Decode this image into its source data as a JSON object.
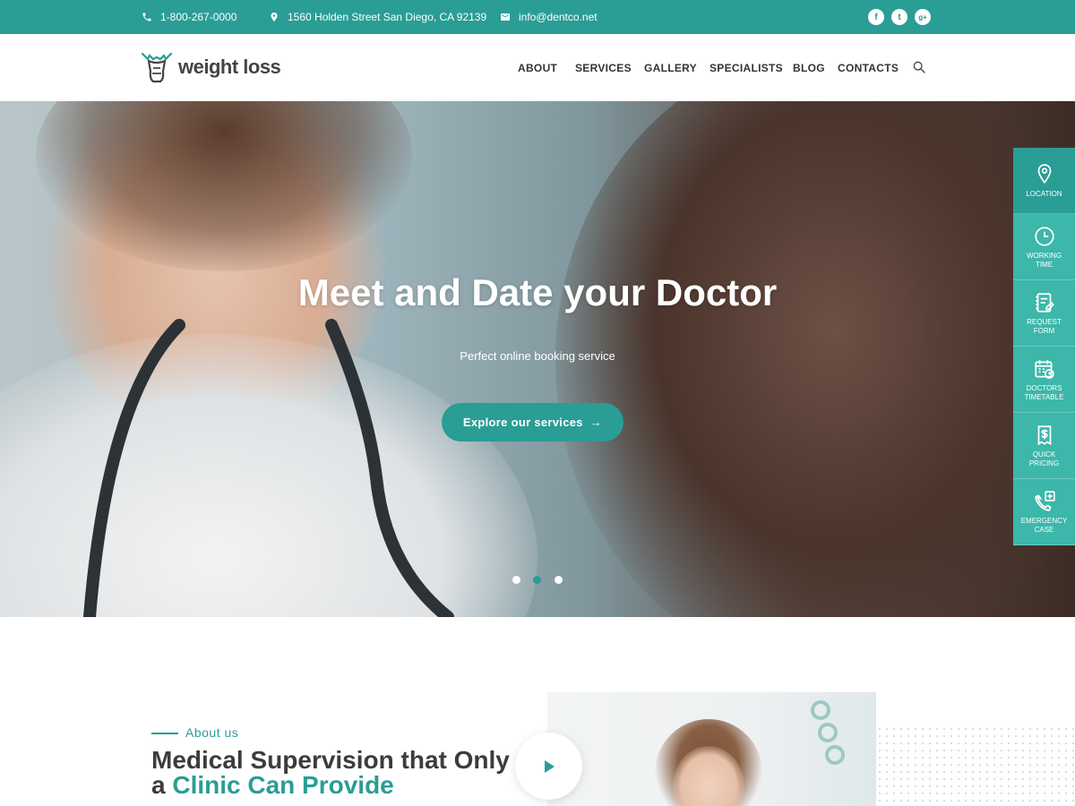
{
  "topbar": {
    "phone": "1-800-267-0000",
    "address": "1560 Holden Street San Diego, CA 92139",
    "email": "info@dentco.net",
    "social": [
      {
        "icon": "facebook-icon",
        "glyph": "f"
      },
      {
        "icon": "twitter-icon",
        "glyph": "t"
      },
      {
        "icon": "google-plus-icon",
        "glyph": "g+"
      }
    ]
  },
  "header": {
    "logo_text": "weight loss",
    "nav": [
      "ABOUT",
      "SERVICES",
      "GALLERY",
      "SPECIALISTS",
      "BLOG",
      "CONTACTS"
    ]
  },
  "hero": {
    "title": "Meet and Date your Doctor",
    "subtitle": "Perfect online booking service",
    "cta_label": "Explore our services",
    "cta_arrow": "→",
    "slides": 3,
    "active_slide": 2
  },
  "side_panel": [
    {
      "icon": "location-pin-icon",
      "label": "LOCATION"
    },
    {
      "icon": "clock-icon",
      "label": "WORKING TIME"
    },
    {
      "icon": "request-form-icon",
      "label": "REQUEST FORM"
    },
    {
      "icon": "calendar-icon",
      "label": "DOCTORS TIMETABLE"
    },
    {
      "icon": "pricing-icon",
      "label": "QUICK PRICING"
    },
    {
      "icon": "emergency-phone-icon",
      "label": "EMERGENCY CASE"
    }
  ],
  "about": {
    "label": "About us",
    "title_part1": "Medical Supervision that Only a ",
    "title_accent": "Clinic Can Provide"
  },
  "colors": {
    "accent": "#2a9d95",
    "side_panel": "#3cb7aa"
  }
}
